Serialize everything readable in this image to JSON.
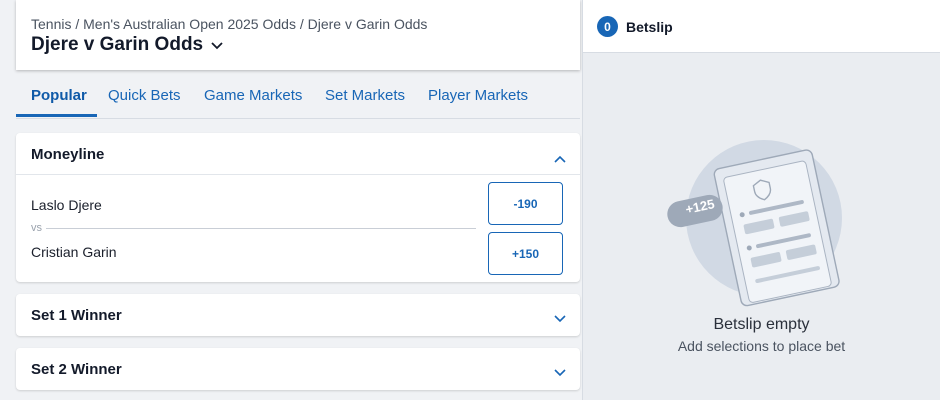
{
  "header": {
    "breadcrumb": "Tennis / Men's Australian Open 2025 Odds / Djere v Garin Odds",
    "title": "Djere v Garin Odds"
  },
  "tabs": [
    "Popular",
    "Quick Bets",
    "Game Markets",
    "Set Markets",
    "Player Markets"
  ],
  "moneyline": {
    "title": "Moneyline",
    "player1": "Laslo Djere",
    "player2": "Cristian Garin",
    "vs": "vs",
    "odds1": "-190",
    "odds2": "+150"
  },
  "set1": {
    "title": "Set 1 Winner"
  },
  "set2": {
    "title": "Set 2 Winner"
  },
  "betslip": {
    "count": "0",
    "title": "Betslip",
    "badge": "+125",
    "empty_title": "Betslip empty",
    "empty_sub": "Add selections to place bet"
  },
  "colors": {
    "accent": "#1866b6",
    "text": "#131a2a"
  }
}
